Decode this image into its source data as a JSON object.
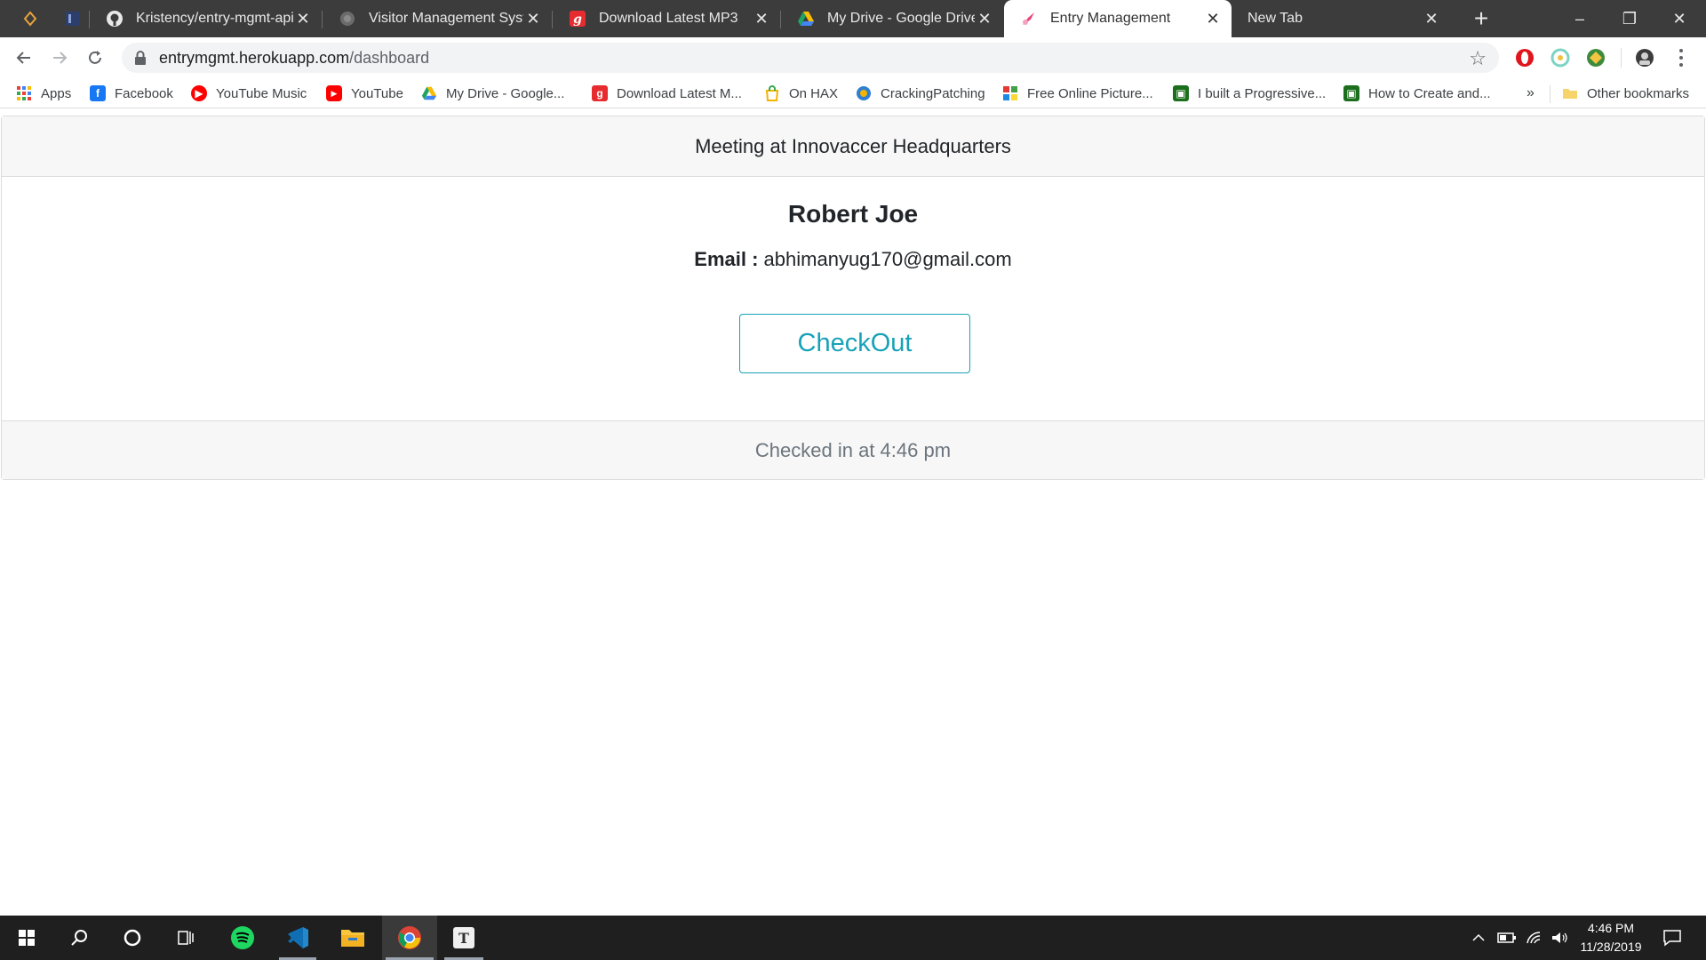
{
  "browser": {
    "tabs": [
      {
        "title": "Kristency/entry-mgmt-api",
        "icon": "github-icon"
      },
      {
        "title": "Visitor Management Syste",
        "icon": "globe-icon"
      },
      {
        "title": "Download Latest MP3",
        "icon": "gaana-icon"
      },
      {
        "title": "My Drive - Google Drive",
        "icon": "google-drive-icon"
      },
      {
        "title": "Entry Management",
        "icon": "entry-app-icon"
      },
      {
        "title": "New Tab",
        "icon": ""
      }
    ],
    "active_tab_index": 4,
    "new_tab_symbol": "+",
    "close_symbol": "✕",
    "window_controls": {
      "minimize": "–",
      "restore": "❐",
      "close": "✕"
    },
    "url": {
      "host": "entrymgmt.herokuapp.com",
      "path": "/dashboard"
    },
    "bookmarks": [
      {
        "label": "Apps",
        "icon": "apps-grid-icon"
      },
      {
        "label": "Facebook",
        "icon": "facebook-icon"
      },
      {
        "label": "YouTube Music",
        "icon": "youtube-music-icon"
      },
      {
        "label": "YouTube",
        "icon": "youtube-icon"
      },
      {
        "label": "My Drive - Google...",
        "icon": "google-drive-icon"
      },
      {
        "label": "Download Latest M...",
        "icon": "gaana-icon"
      },
      {
        "label": "On HAX",
        "icon": "bag-icon"
      },
      {
        "label": "CrackingPatching",
        "icon": "cp-icon"
      },
      {
        "label": "Free Online Picture...",
        "icon": "collage-icon"
      },
      {
        "label": "I built a Progressive...",
        "icon": "image-icon"
      },
      {
        "label": "How to Create and...",
        "icon": "image-icon"
      }
    ],
    "bookmarks_overflow": "»",
    "other_bookmarks": "Other bookmarks"
  },
  "page": {
    "header": "Meeting at Innovaccer Headquarters",
    "visitor_name": "Robert Joe",
    "email_label": "Email :",
    "email_value": "abhimanyug170@gmail.com",
    "checkout_button": "CheckOut",
    "footer": "Checked in at 4:46 pm",
    "accent_color": "#17a2b8"
  },
  "taskbar": {
    "apps": [
      "windows-start-icon",
      "search-icon",
      "cortana-icon",
      "task-view-icon",
      "spotify-icon",
      "vscode-icon",
      "file-explorer-icon",
      "chrome-icon",
      "typora-icon"
    ],
    "time": "4:46 PM",
    "date": "11/28/2019"
  }
}
